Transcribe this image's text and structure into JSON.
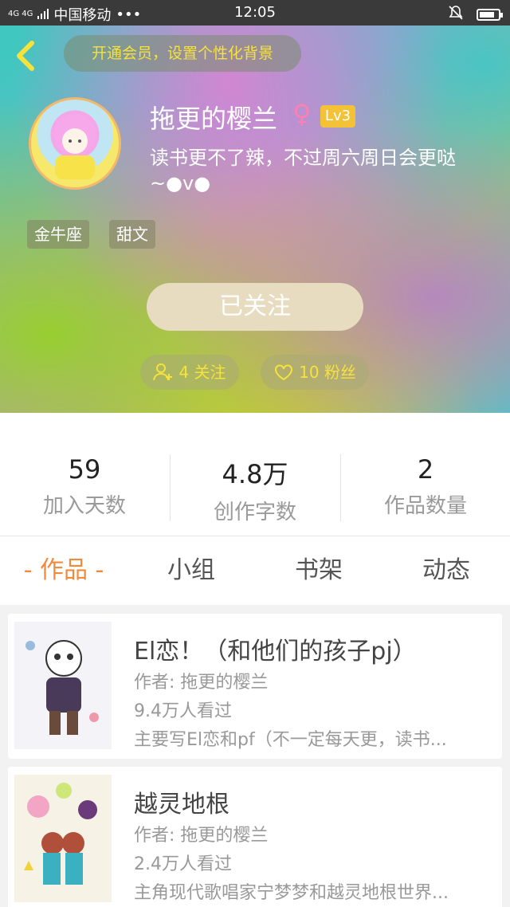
{
  "status_bar": {
    "network": "4G 4G",
    "carrier": "中国移动",
    "dots": "•••",
    "time": "12:05",
    "battery_level": 0.8
  },
  "header": {
    "vip_banner": "开通会员，设置个性化背景",
    "username": "拖更的樱兰",
    "gender_symbol": "♀",
    "level": "Lv3",
    "bio": "读书更不了辣，不过周六周日会更哒~●v●",
    "tags": [
      "金牛座",
      "甜文"
    ],
    "follow_button": "已关注",
    "following": "4 关注",
    "followers": "10 粉丝"
  },
  "stats": [
    {
      "value": "59",
      "label": "加入天数"
    },
    {
      "value": "4.8万",
      "label": "创作字数"
    },
    {
      "value": "2",
      "label": "作品数量"
    }
  ],
  "tabs": [
    {
      "label": "- 作品 -",
      "active": true
    },
    {
      "label": "小组",
      "active": false
    },
    {
      "label": "书架",
      "active": false
    },
    {
      "label": "动态",
      "active": false
    }
  ],
  "works": [
    {
      "title": "El恋！（和他们的孩子pj）",
      "author": "作者: 拖更的樱兰",
      "views": "9.4万人看过",
      "desc": "主要写El恋和pf（不一定每天更，读书..."
    },
    {
      "title": "越灵地根",
      "author": "作者: 拖更的樱兰",
      "views": "2.4万人看过",
      "desc": "主角现代歌唱家宁梦梦和越灵地根世界..."
    }
  ],
  "colors": {
    "accent": "#f08a3c",
    "highlight": "#f6e23c",
    "level_badge": "#f3c236"
  }
}
